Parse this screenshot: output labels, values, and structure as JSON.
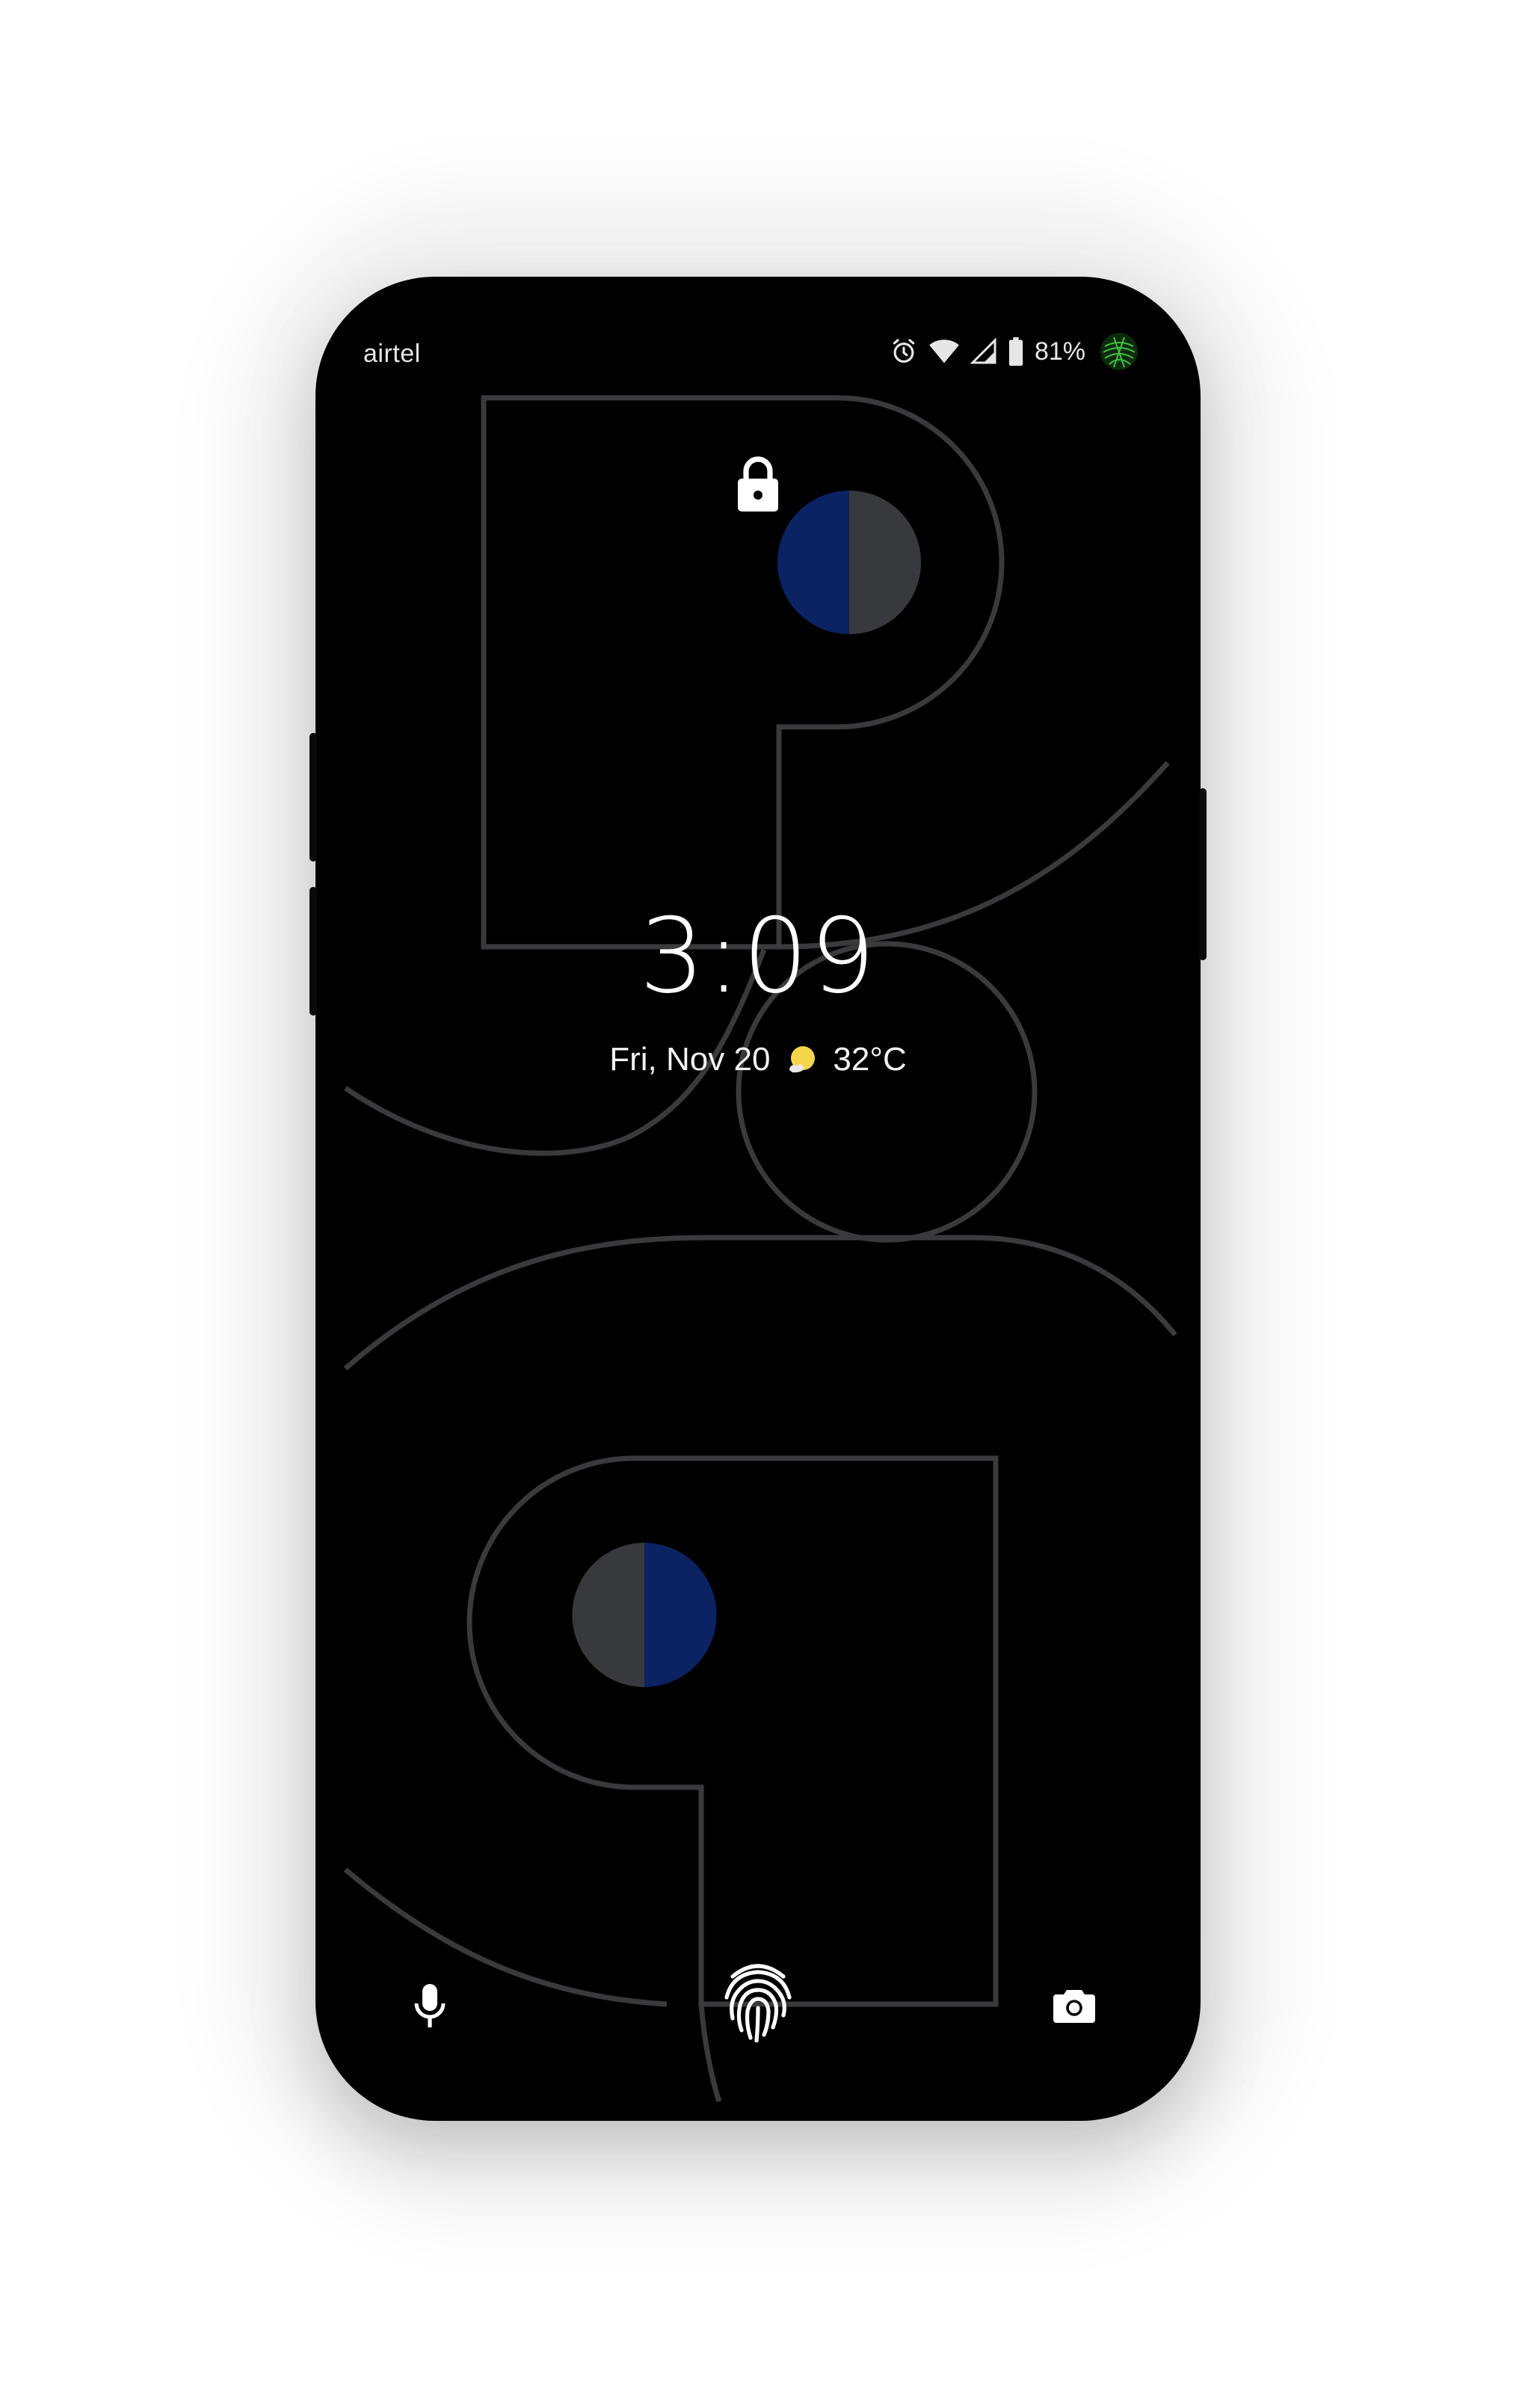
{
  "status_bar": {
    "carrier": "airtel",
    "battery_percent": "81%",
    "icons": [
      "alarm-icon",
      "wifi-icon",
      "cell-signal-icon",
      "battery-icon",
      "avatar"
    ]
  },
  "lockscreen": {
    "lock_icon": "lock-icon",
    "time": "3:09",
    "date": "Fri, Nov 20",
    "weather_icon": "partly-sunny-icon",
    "temperature": "32°C"
  },
  "bottom_actions": {
    "left": "mic-icon",
    "center": "fingerprint-icon",
    "right": "camera-icon"
  },
  "colors": {
    "screen_background": "#000000",
    "wallpaper_line": "#3a3a3d",
    "accent_blue": "#0b2263",
    "accent_gray": "#38393c",
    "sun": "#f7d54a"
  }
}
